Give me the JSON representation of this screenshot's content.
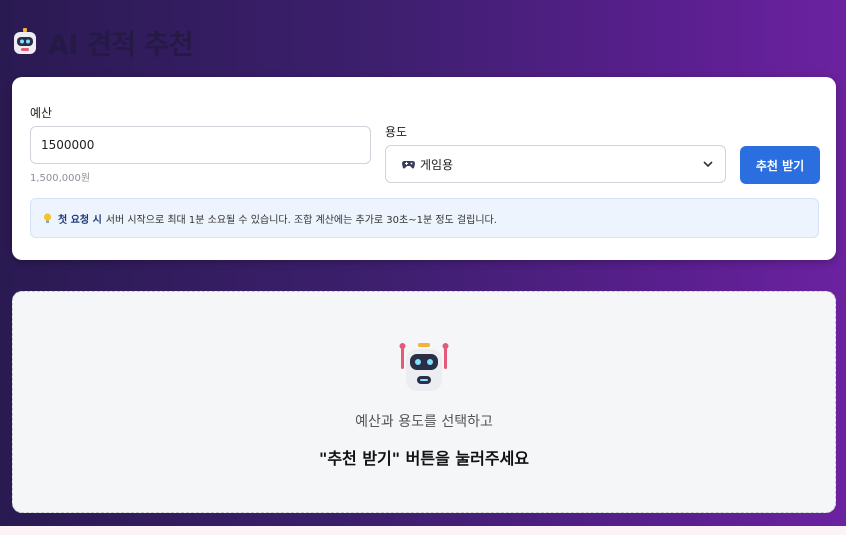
{
  "header": {
    "title": "AI 견적 추천",
    "logo_icon": "robot-icon"
  },
  "form": {
    "budget_label": "예산",
    "budget_value": "1500000",
    "budget_formatted": "1,500,000원",
    "usage_label": "용도",
    "usage_icon": "gamepad-icon",
    "usage_value": "게임용",
    "submit_label": "추천 받기"
  },
  "notice": {
    "icon": "lightbulb-icon",
    "bold": "첫 요청 시",
    "text": "서버 시작으로 최대 1분 소요될 수 있습니다. 조합 계산에는 추가로 30초~1분 정도 걸립니다."
  },
  "result": {
    "icon": "robot-icon",
    "subtitle": "예산과 용도를 선택하고",
    "instruction": "\"추천 받기\" 버튼을 눌러주세요"
  },
  "colors": {
    "accent": "#2a6ee0",
    "background_start": "#2a1a52",
    "background_end": "#6b22a0"
  }
}
